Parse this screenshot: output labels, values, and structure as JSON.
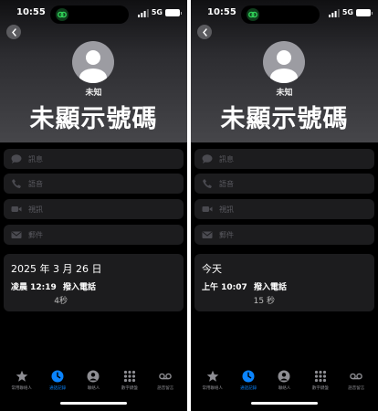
{
  "colors": {
    "accent": "#0a84ff",
    "card": "#1c1c1e",
    "muted": "#5a5a60"
  },
  "phones": [
    {
      "status": {
        "time": "10:55",
        "network": "5G"
      },
      "caller": {
        "label": "未知",
        "name": "未顯示號碼"
      },
      "actions": [
        {
          "label": "訊息",
          "icon": "message-bubble-icon"
        },
        {
          "label": "語音",
          "icon": "phone-icon"
        },
        {
          "label": "視訊",
          "icon": "video-icon"
        },
        {
          "label": "郵件",
          "icon": "mail-icon"
        }
      ],
      "call": {
        "date": "2025 年 3 月 26 日",
        "time": "凌晨 12:19",
        "type": "撥入電話",
        "duration": "4秒"
      },
      "tabs": [
        {
          "label": "常用聯絡人",
          "icon": "star-icon"
        },
        {
          "label": "通話記錄",
          "icon": "clock-icon",
          "active": true
        },
        {
          "label": "聯絡人",
          "icon": "person-icon"
        },
        {
          "label": "數字鍵盤",
          "icon": "keypad-icon"
        },
        {
          "label": "語音留言",
          "icon": "voicemail-icon"
        }
      ]
    },
    {
      "status": {
        "time": "10:55",
        "network": "5G"
      },
      "caller": {
        "label": "未知",
        "name": "未顯示號碼"
      },
      "actions": [
        {
          "label": "訊息",
          "icon": "message-bubble-icon"
        },
        {
          "label": "語音",
          "icon": "phone-icon"
        },
        {
          "label": "視訊",
          "icon": "video-icon"
        },
        {
          "label": "郵件",
          "icon": "mail-icon"
        }
      ],
      "call": {
        "date": "今天",
        "time": "上午 10:07",
        "type": "撥入電話",
        "duration": "15 秒"
      },
      "tabs": [
        {
          "label": "常用聯絡人",
          "icon": "star-icon"
        },
        {
          "label": "通話記錄",
          "icon": "clock-icon",
          "active": true
        },
        {
          "label": "聯絡人",
          "icon": "person-icon"
        },
        {
          "label": "數字鍵盤",
          "icon": "keypad-icon"
        },
        {
          "label": "語音留言",
          "icon": "voicemail-icon"
        }
      ]
    }
  ]
}
